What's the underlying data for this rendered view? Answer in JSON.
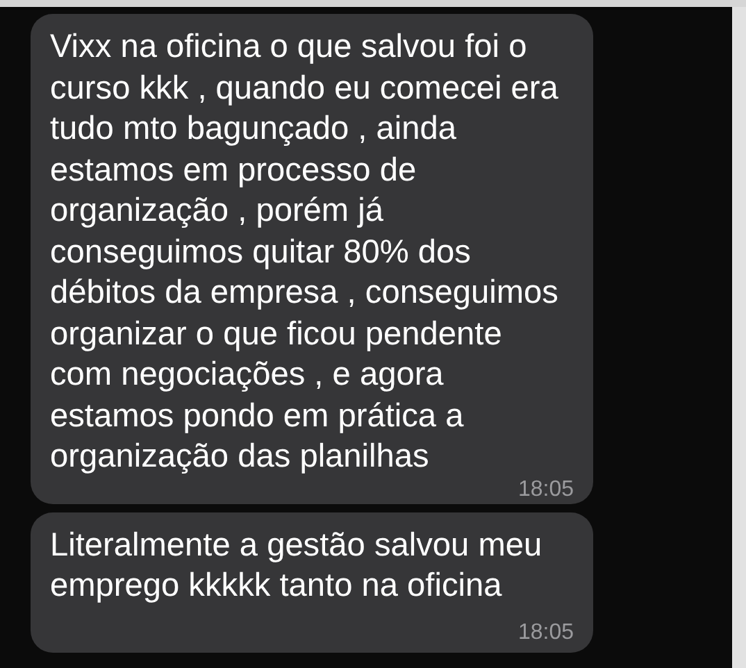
{
  "messages": [
    {
      "text": "Vixx na oficina o que salvou foi o\ncurso kkk , quando eu comecei era\ntudo mto bagunçado , ainda\nestamos em processo de\norganização , porém já\nconseguimos quitar 80% dos\ndébitos da empresa , conseguimos\norganizar o que ficou pendente\ncom negociações , e agora\nestamos pondo em prática a\norganização das planilhas",
      "time": "18:05",
      "time_inline": true
    },
    {
      "text": "Literalmente a gestão salvou meu\nemprego kkkkk tanto na oficina",
      "time": "18:05",
      "time_inline": false
    }
  ]
}
